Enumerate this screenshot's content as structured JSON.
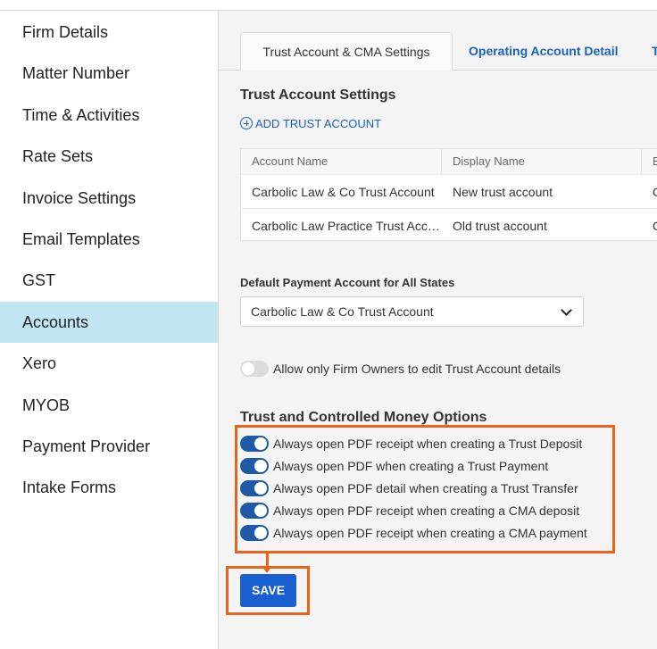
{
  "sidebar": {
    "items": [
      {
        "label": "Firm Details"
      },
      {
        "label": "Matter Number"
      },
      {
        "label": "Time & Activities"
      },
      {
        "label": "Rate Sets"
      },
      {
        "label": "Invoice Settings"
      },
      {
        "label": "Email Templates"
      },
      {
        "label": "GST"
      },
      {
        "label": "Accounts",
        "active": true
      },
      {
        "label": "Xero"
      },
      {
        "label": "MYOB"
      },
      {
        "label": "Payment Provider"
      },
      {
        "label": "Intake Forms"
      }
    ]
  },
  "tabs": [
    {
      "label": "Trust Account & CMA Settings",
      "active": true
    },
    {
      "label": "Operating Account Detail"
    },
    {
      "label": "T"
    }
  ],
  "trust_settings": {
    "title": "Trust Account Settings",
    "add_label": "ADD TRUST ACCOUNT",
    "columns": [
      "Account Name",
      "Display Name",
      "B"
    ],
    "rows": [
      {
        "account_name": "Carbolic Law & Co Trust Account",
        "display_name": "New trust account",
        "third": "C"
      },
      {
        "account_name": "Carbolic Law Practice Trust Account",
        "display_name": "Old trust account",
        "third": "C"
      }
    ]
  },
  "default_payment": {
    "label": "Default Payment Account for All States",
    "selected": "Carbolic Law & Co Trust Account"
  },
  "owner_toggle": {
    "label": "Allow only Firm Owners to edit Trust Account details",
    "state": "off"
  },
  "options": {
    "title": "Trust and Controlled Money Options",
    "items": [
      {
        "label": "Always open PDF receipt when creating a Trust Deposit",
        "state": "on"
      },
      {
        "label": "Always open PDF when creating a Trust Payment",
        "state": "on"
      },
      {
        "label": "Always open PDF detail when creating a Trust Transfer",
        "state": "on"
      },
      {
        "label": "Always open PDF receipt when creating a CMA deposit",
        "state": "on"
      },
      {
        "label": "Always open PDF receipt when creating a CMA payment",
        "state": "on"
      }
    ]
  },
  "save_label": "SAVE",
  "colors": {
    "accent": "#1a5fd0",
    "active_sidebar": "#c1e6f2",
    "highlight": "#e8641c",
    "toggle_on": "#1f5aa6"
  }
}
